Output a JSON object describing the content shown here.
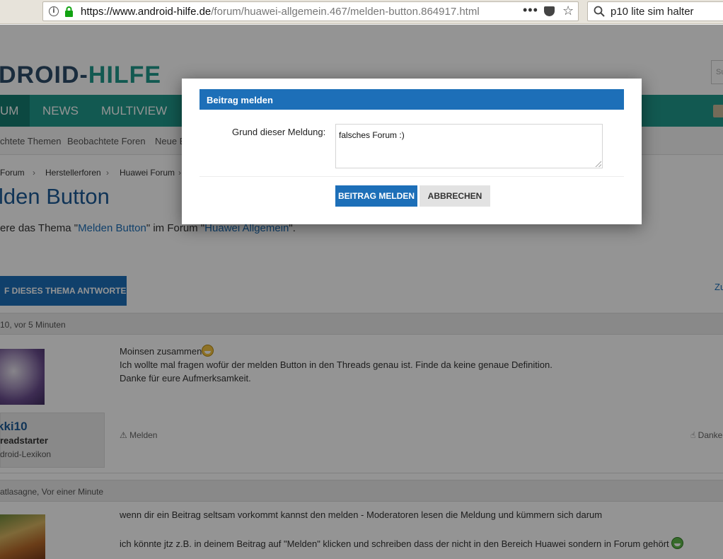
{
  "browser": {
    "url_host": "https://www.android-hilfe.de",
    "url_path": "/forum/huawei-allgemein.467/melden-button.864917.html",
    "menu_glyph": "•••",
    "search_query": "p10 lite sim halter"
  },
  "site": {
    "logo_part1": "DROID-",
    "logo_part2": "HILFE",
    "search_stub": "Su"
  },
  "nav": {
    "items": [
      "UM",
      "NEWS",
      "MULTIVIEW"
    ]
  },
  "subnav": {
    "items": [
      "chtete Themen",
      "Beobachtete Foren",
      "Neue B"
    ]
  },
  "breadcrumb": {
    "items": [
      "Forum",
      "Herstellerforen",
      "Huawei Forum"
    ],
    "sep": "›"
  },
  "thread": {
    "title": "lden Button",
    "subtitle_pre": "ere das Thema \"",
    "subtitle_topic": "Melden Button",
    "subtitle_mid": "\" im Forum \"",
    "subtitle_forum": "Huawei Allgemein",
    "subtitle_post": "\".",
    "reply_button": "F DIESES THEMA ANTWORTEN",
    "right_link": "Zu"
  },
  "posts": [
    {
      "header": "10, vor 5 Minuten",
      "username": "kki10",
      "role": "readstarter",
      "rank": "droid-Lexikon",
      "line1": "Moinsen zusammen",
      "line2": "Ich wollte mal fragen wofür der melden Button in den Threads genau ist. Finde da keine genaue Definition.",
      "line3": "Danke für eure Aufmerksamkeit.",
      "report_link": "Melden",
      "thanks_link": "Danke"
    },
    {
      "header": "atlasagne, Vor einer Minute",
      "line1": "wenn dir ein Beitrag seltsam vorkommt kannst den melden - Moderatoren lesen die Meldung und kümmern sich darum",
      "line2": "ich könnte jtz z.B. in deinem Beitrag auf \"Melden\" klicken und schreiben dass der nicht in den Bereich Huawei sondern in Forum gehört"
    }
  ],
  "dialog": {
    "title": "Beitrag melden",
    "label": "Grund dieser Meldung:",
    "reason_value": "falsches Forum :)",
    "submit_label": "BEITRAG MELDEN",
    "cancel_label": "ABBRECHEN"
  },
  "colors": {
    "accent": "#1d6fb8",
    "nav_bg": "#1f9a8c",
    "overlay": "rgba(0,0,0,0.42)"
  }
}
